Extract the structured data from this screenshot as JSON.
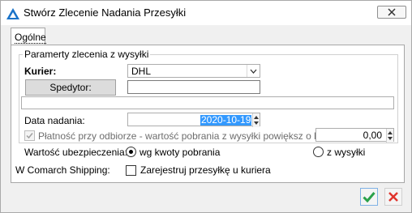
{
  "window": {
    "title": "Stwórz Zlecenie Nadania Przesyłki",
    "close_icon": "close-icon",
    "app_icon": "comarch-logo-icon"
  },
  "tabs": [
    {
      "label": "Ogólne",
      "active": true
    }
  ],
  "group": {
    "legend": "Paramerty zlecenia z wysyłki"
  },
  "form": {
    "kurier_label": "Kurier:",
    "kurier_value": "DHL",
    "spedytor_button": "Spedytor:",
    "spedytor_value": "",
    "notes_value": "",
    "data_nadania_label": "Data nadania:",
    "data_nadania_value": "2020-10-19",
    "platnosc_label": "Płatność przy odbiorze - wartość pobrania z wysyłki powiększ o kwotę:",
    "platnosc_checked": true,
    "platnosc_enabled": false,
    "platnosc_value": "0,00",
    "wartosc_label": "Wartość ubezpieczenia:",
    "wartosc_option1": "wg kwoty pobrania",
    "wartosc_option2": "z wysyłki",
    "wartosc_selected": "wg kwoty pobrania",
    "shipping_label": "W Comarch Shipping:",
    "shipping_checkbox_label": "Zarejestruj przesyłkę u kuriera",
    "shipping_checked": false
  },
  "actions": {
    "ok_icon": "checkmark-icon",
    "cancel_icon": "close-icon",
    "accent_ok": "#2aa14a",
    "accent_cancel": "#e0342c"
  }
}
